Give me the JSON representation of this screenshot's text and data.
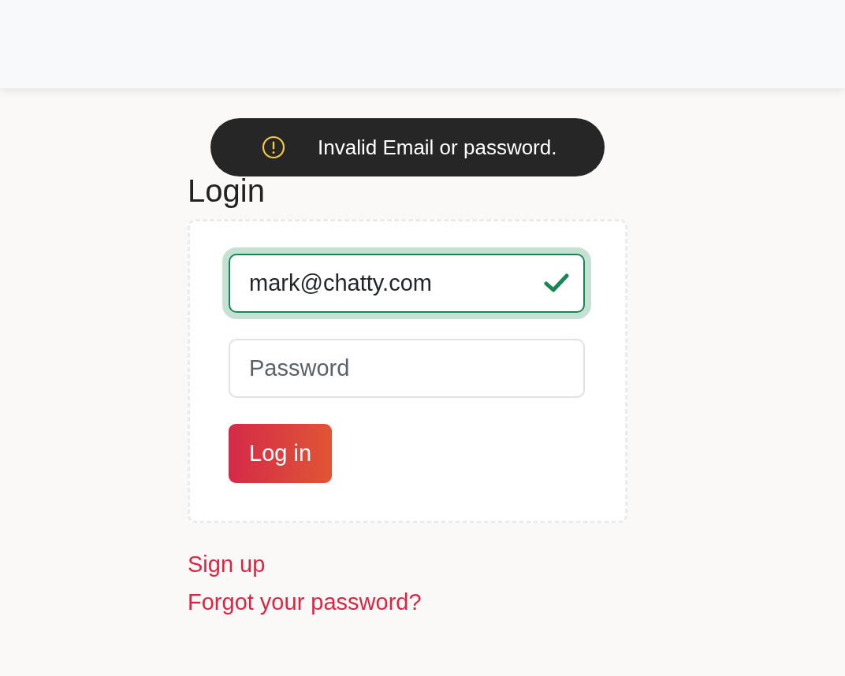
{
  "toast": {
    "kind": "warning",
    "message": "Invalid Email or password."
  },
  "heading": "Login",
  "form": {
    "email": {
      "value": "mark@chatty.com",
      "valid": true,
      "focused": true
    },
    "password": {
      "placeholder": "Password"
    },
    "submit": "Log in"
  },
  "links": [
    "Sign up",
    "Forgot your password?"
  ]
}
